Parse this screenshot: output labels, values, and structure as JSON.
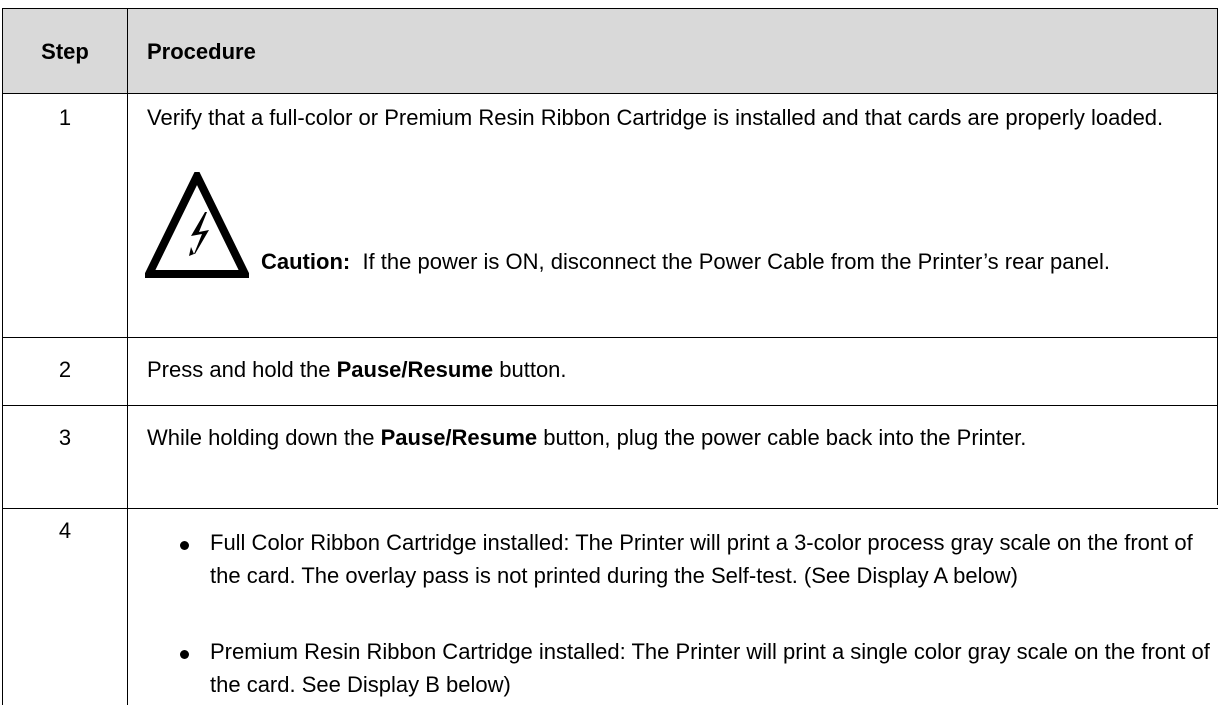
{
  "table": {
    "headers": {
      "step": "Step",
      "procedure": "Procedure"
    },
    "rows": [
      {
        "step": "1",
        "text": "Verify that a full-color or Premium Resin Ribbon Cartridge is installed and that cards are properly loaded.",
        "caution_label": "Caution:",
        "caution_text": "If the power is ON, disconnect the Power Cable from the Printer’s rear panel.",
        "icon": "electrical-hazard-icon"
      },
      {
        "step": "2",
        "pre": "Press and hold the",
        "bold": "Pause/Resume",
        "post": "button."
      },
      {
        "step": "3",
        "pre": "While holding down the",
        "bold": "Pause/Resume",
        "post": "button, plug the power cable back into the Printer."
      },
      {
        "step": "4",
        "bullets": [
          "Full Color Ribbon Cartridge installed: The Printer will print a 3-color process gray scale on the front of the card. The overlay pass is not printed during the Self-test. (See Display A below)",
          "Premium Resin Ribbon Cartridge installed:  The Printer will print a single color gray scale on the front of the card. See Display B below)"
        ]
      }
    ]
  }
}
